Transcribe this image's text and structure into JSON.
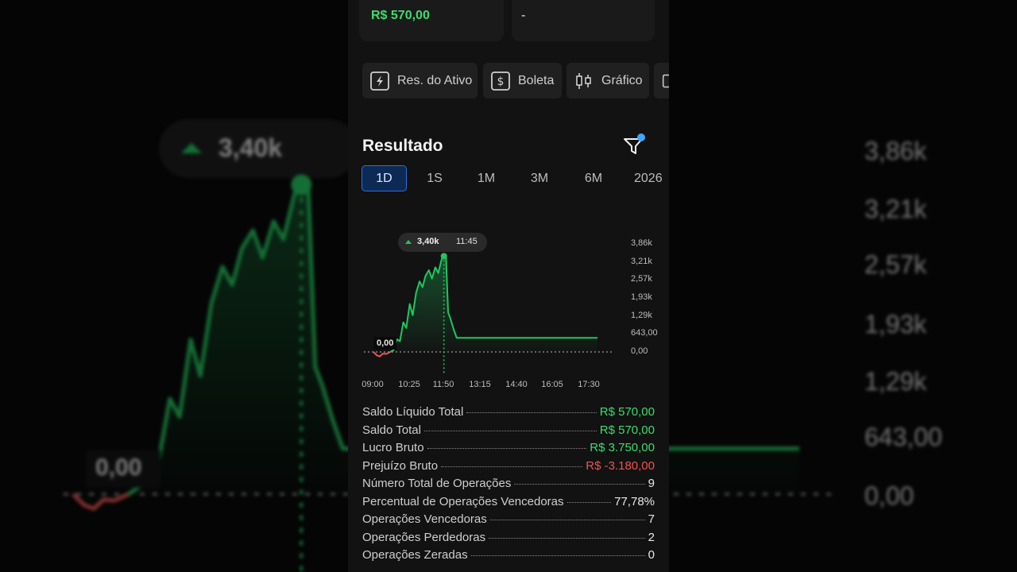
{
  "top_cards": [
    {
      "value": "R$ 570,00",
      "color": "#3ddc6e"
    },
    {
      "value": "-",
      "color": "#e8e8e8"
    }
  ],
  "tabs": [
    {
      "label": "Res. do Ativo",
      "icon": "lightning-square-icon"
    },
    {
      "label": "Boleta",
      "icon": "dollar-square-icon"
    },
    {
      "label": "Gráfico",
      "icon": "candlestick-icon"
    }
  ],
  "section_title": "Resultado",
  "periods": [
    "1D",
    "1S",
    "1M",
    "3M",
    "6M",
    "2026"
  ],
  "active_period": "1D",
  "chart_data": {
    "type": "line",
    "y_ticks": [
      "3,86k",
      "3,21k",
      "2,57k",
      "1,93k",
      "1,29k",
      "643,00",
      "0,00"
    ],
    "x_ticks": [
      "09:00",
      "10:25",
      "11:50",
      "13:15",
      "14:40",
      "16:05",
      "17:30"
    ],
    "ylim": [
      -200,
      3860
    ],
    "tooltip": {
      "value": "3,40k",
      "time": "11:45"
    },
    "zero_label": "0,00",
    "series": [
      {
        "color": "#22c55e",
        "x": [
          "09:00",
          "09:08",
          "09:15",
          "09:22",
          "09:30",
          "09:40",
          "09:48",
          "09:55",
          "10:02",
          "10:10",
          "10:17",
          "10:25",
          "10:32",
          "10:40",
          "10:48",
          "10:55",
          "11:02",
          "11:10",
          "11:17",
          "11:25",
          "11:32",
          "11:40",
          "11:45",
          "11:50",
          "11:55",
          "12:00",
          "12:08",
          "12:15",
          "17:45"
        ],
        "y": [
          0,
          -120,
          -160,
          -60,
          -70,
          0,
          80,
          450,
          380,
          1050,
          850,
          1700,
          1300,
          2100,
          2500,
          2300,
          2700,
          2900,
          2600,
          3000,
          2800,
          3300,
          3400,
          3380,
          1400,
          1200,
          800,
          500,
          500
        ]
      }
    ]
  },
  "stats": [
    {
      "label": "Saldo Líquido Total",
      "value": "R$ 570,00",
      "tone": "pos"
    },
    {
      "label": "Saldo Total",
      "value": "R$ 570,00",
      "tone": "pos"
    },
    {
      "label": "Lucro Bruto",
      "value": "R$ 3.750,00",
      "tone": "pos"
    },
    {
      "label": "Prejuízo Bruto",
      "value": "R$ -3.180,00",
      "tone": "neg"
    },
    {
      "label": "Número Total de Operações",
      "value": "9",
      "tone": ""
    },
    {
      "label": "Percentual de Operações Vencedoras",
      "value": "77,78%",
      "tone": ""
    },
    {
      "label": "Operações Vencedoras",
      "value": "7",
      "tone": ""
    },
    {
      "label": "Operações Perdedoras",
      "value": "2",
      "tone": ""
    },
    {
      "label": "Operações Zeradas",
      "value": "0",
      "tone": ""
    }
  ]
}
